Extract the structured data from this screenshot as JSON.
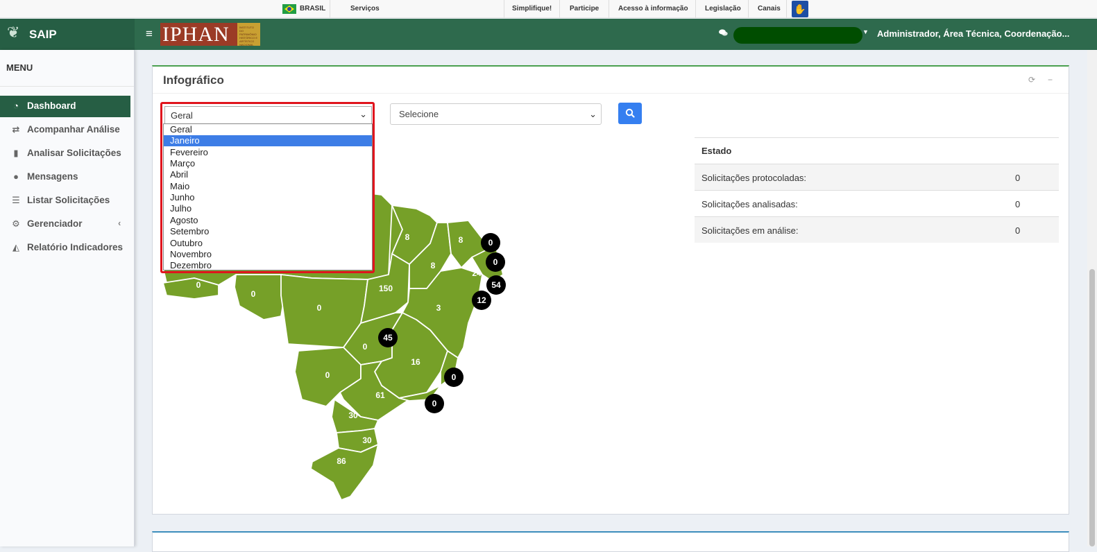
{
  "govbar": {
    "country": "BRASIL",
    "services": "Serviços",
    "links": [
      "Simplifique!",
      "Participe",
      "Acesso à informação",
      "Legislação",
      "Canais"
    ]
  },
  "header": {
    "app_name": "SAIP",
    "logo_text": "IPHAN",
    "logo_small": "INSTITUTO DO PATRIMÔNIO HISTÓRICO E ARTÍSTICO NACIONAL",
    "user_label": "Administrador, Área Técnica, Coordenação..."
  },
  "sidebar": {
    "heading": "MENU",
    "items": [
      {
        "label": "Dashboard",
        "icon": "dashboard-icon"
      },
      {
        "label": "Acompanhar Análise",
        "icon": "exchange-icon"
      },
      {
        "label": "Analisar Solicitações",
        "icon": "book-icon"
      },
      {
        "label": "Mensagens",
        "icon": "comments-icon"
      },
      {
        "label": "Listar Solicitações",
        "icon": "list-icon"
      },
      {
        "label": "Gerenciador",
        "icon": "gears-icon"
      },
      {
        "label": "Relatório Indicadores",
        "icon": "area-chart-icon"
      }
    ]
  },
  "infografico": {
    "title": "Infográfico",
    "month_select": {
      "value": "Geral",
      "options": [
        "Geral",
        "Janeiro",
        "Fevereiro",
        "Março",
        "Abril",
        "Maio",
        "Junho",
        "Julho",
        "Agosto",
        "Setembro",
        "Outubro",
        "Novembro",
        "Dezembro"
      ],
      "highlighted": "Janeiro"
    },
    "second_select": {
      "value": "Selecione"
    },
    "stats": {
      "header": "Estado",
      "rows": [
        {
          "label": "Solicitações protocoladas:",
          "value": "0"
        },
        {
          "label": "Solicitações analisadas:",
          "value": "0"
        },
        {
          "label": "Solicitações em análise:",
          "value": "0"
        }
      ]
    },
    "map_labels": [
      "8",
      "8",
      "8",
      "150",
      "0",
      "0",
      "0",
      "3",
      "24",
      "0",
      "16",
      "0",
      "61",
      "30",
      "30",
      "86"
    ],
    "map_bubbles": [
      "0",
      "0",
      "54",
      "12",
      "45",
      "0",
      "0"
    ],
    "colors": {
      "map_fill": "#76a028",
      "primary_green": "#2e6a4d",
      "highlight": "#e0141d"
    }
  }
}
